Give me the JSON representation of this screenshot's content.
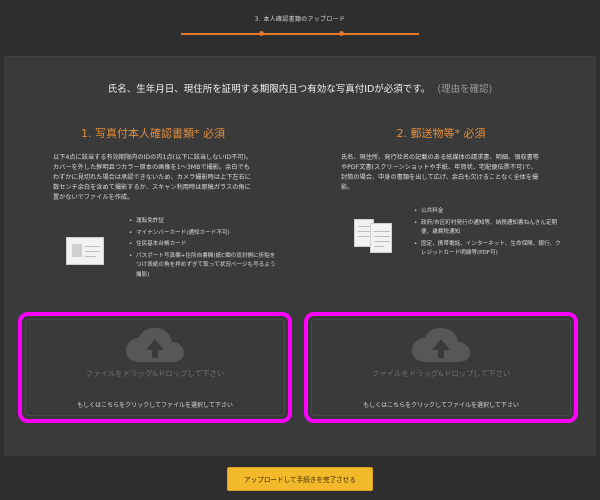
{
  "header": {
    "step_title": "3. 本人確認書類のアップロード",
    "accent_color": "#e07a2a"
  },
  "main": {
    "headline": "氏名、生年月日、現住所を証明する期限内且つ有効な写真付IDが必須です。",
    "reason_link": "(理由を確認)"
  },
  "left": {
    "title": "1. 写真付本人確認書類* 必須",
    "description": "以下4点に該当する有効期限内のIDの内1点(以下に該当しないID不可)。カバーを外した鮮明且つカラー原本の画像を1～3MBで撮影。余白でもわずかに見切れた場合は承認できないため、カメラ撮影時は上下左右に数センチ余白を含めて撮影するか、スキャン利用時は原稿ガラスの角に置かないでファイルを作成。",
    "bullets": [
      "運転免許証",
      "マイナンバーカード(通知カード不可)",
      "住民基本台帳カード",
      "パスポート写真欄+住所自書欄(紙C類の双対側に折貼をつけ表紙の角を拝めずぎて取って状況ページも写るよう撮影)"
    ],
    "icon": "id-card-icon"
  },
  "right": {
    "title": "2. 郵送物等* 必須",
    "description": "氏名、現住所、発行社名の記載のある紙媒体の請求書、明細、領収書等やPDF文書(スクリーンショットや手紙、年賀状、宅配便伝票不可)で、封筒の場合、中身の書類を出して広げ、余白も欠けることなく全体を撮影。",
    "bullets": [
      "公共料金",
      "政府/市区町村発行の通知等、納税通知書ねんきん定期便、歳費税通知",
      "固定、携帯電話、インターネット、生命保険、銀行、クレジットカード明細等(PDF可)"
    ],
    "icon": "documents-icon"
  },
  "dropzones": {
    "title": "ファイルをドラッグ&ドロップして下さい",
    "subtitle": "もしくはこちらをクリックしてファイルを選択して下さい",
    "highlight_color": "#ff00ff",
    "icon": "cloud-upload-icon"
  },
  "footer": {
    "submit_label": "アップロードして手続きを完了させる",
    "button_color": "#f2b92b"
  }
}
